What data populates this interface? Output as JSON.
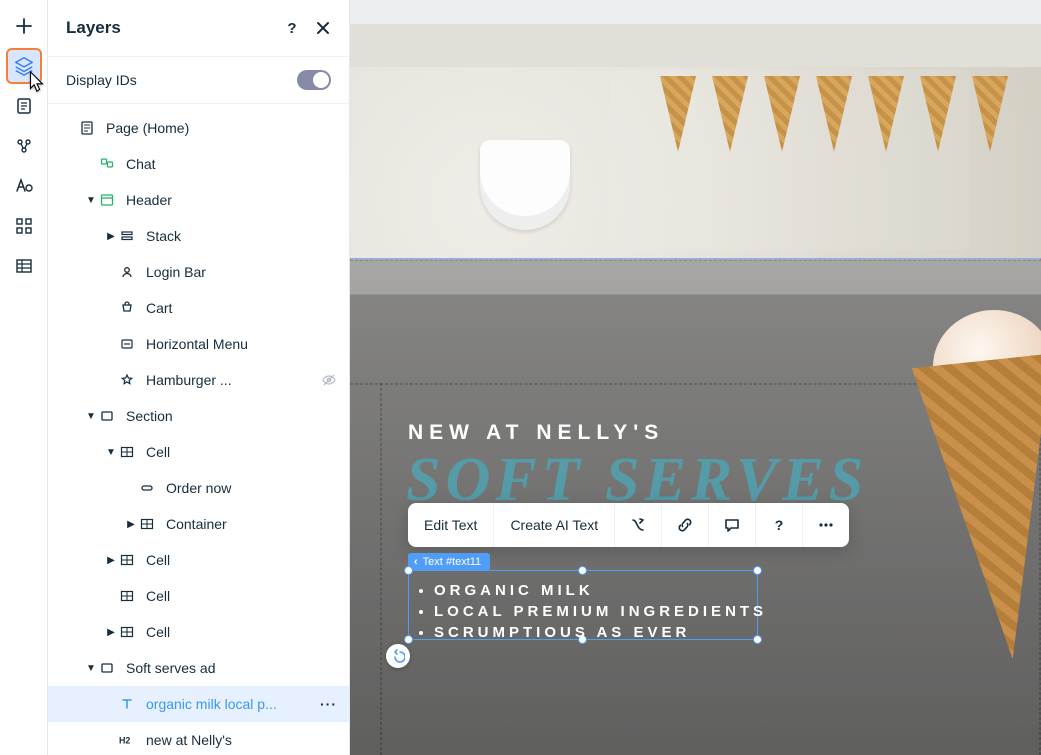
{
  "toolbar_icons": [
    "plus",
    "layers",
    "document",
    "share-nodes",
    "text-style",
    "widgets-grid",
    "table"
  ],
  "panel": {
    "title": "Layers",
    "display_ids_label": "Display IDs"
  },
  "tree": [
    {
      "depth": 0,
      "caret": "",
      "icon": "page",
      "label": "Page (Home)"
    },
    {
      "depth": 1,
      "caret": "",
      "icon": "chat",
      "label": "Chat"
    },
    {
      "depth": 1,
      "caret": "down",
      "icon": "header",
      "label": "Header"
    },
    {
      "depth": 2,
      "caret": "right",
      "icon": "stack",
      "label": "Stack"
    },
    {
      "depth": 2,
      "caret": "",
      "icon": "user",
      "label": "Login Bar"
    },
    {
      "depth": 2,
      "caret": "",
      "icon": "cart",
      "label": "Cart"
    },
    {
      "depth": 2,
      "caret": "",
      "icon": "menu",
      "label": "Horizontal Menu"
    },
    {
      "depth": 2,
      "caret": "",
      "icon": "star",
      "label": "Hamburger ...",
      "hidden": true
    },
    {
      "depth": 1,
      "caret": "down",
      "icon": "section",
      "label": "Section"
    },
    {
      "depth": 2,
      "caret": "down",
      "icon": "cell",
      "label": "Cell"
    },
    {
      "depth": 3,
      "caret": "",
      "icon": "pill",
      "label": "Order now"
    },
    {
      "depth": 3,
      "caret": "right",
      "icon": "cell",
      "label": "Container"
    },
    {
      "depth": 2,
      "caret": "right",
      "icon": "cell",
      "label": "Cell"
    },
    {
      "depth": 2,
      "caret": "",
      "icon": "cell",
      "label": "Cell"
    },
    {
      "depth": 2,
      "caret": "right",
      "icon": "cell",
      "label": "Cell"
    },
    {
      "depth": 1,
      "caret": "down",
      "icon": "section",
      "label": "Soft serves ad"
    },
    {
      "depth": 2,
      "caret": "",
      "icon": "text",
      "label": "organic milk local p...",
      "selected": true,
      "more": true
    },
    {
      "depth": 2,
      "caret": "",
      "icon": "h2",
      "label": "new at Nelly's"
    }
  ],
  "canvas": {
    "headline_small": "NEW AT NELLY'S",
    "headline_script": "SOFT SERVES",
    "selection_label": "Text #text11",
    "bullets": [
      "Organic milk",
      "Local premium ingredients",
      "Scrumptious as ever"
    ]
  },
  "floating_toolbar": {
    "edit_text": "Edit Text",
    "create_ai": "Create AI Text"
  }
}
